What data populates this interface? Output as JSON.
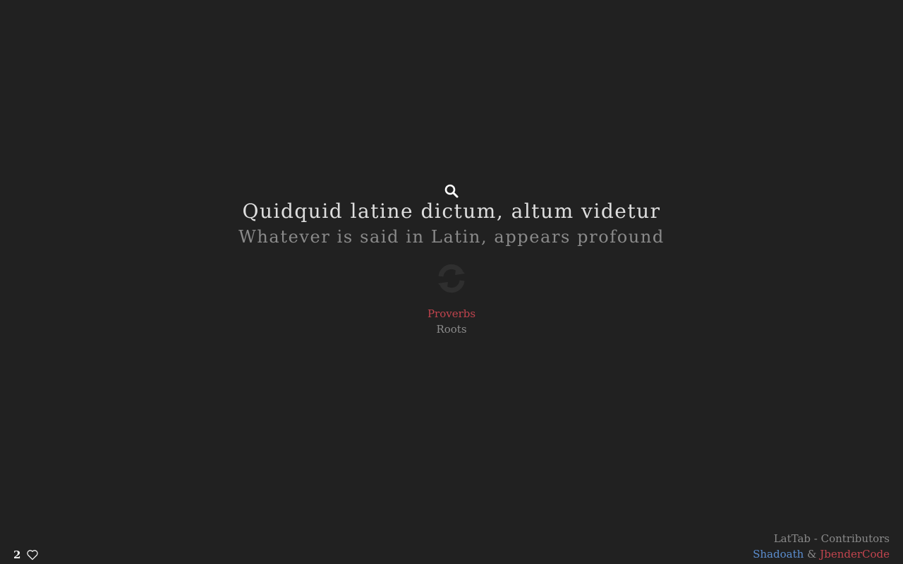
{
  "quote": {
    "latin": "Quidquid latine dictum, altum videtur",
    "english": "Whatever is said in Latin, appears profound"
  },
  "categories": [
    {
      "label": "Proverbs",
      "active": true,
      "color": "#c2444e"
    },
    {
      "label": "Roots",
      "active": false,
      "color": "#8c8c8c"
    }
  ],
  "likes": {
    "count": "2"
  },
  "footer": {
    "title": "LatTab - Contributors",
    "contributors": [
      {
        "name": "Shadoath",
        "color": "#5b8ed0"
      },
      {
        "name": "JbenderCode",
        "color": "#c2444e"
      }
    ],
    "separator": "&"
  },
  "icons": {
    "search": "search-icon",
    "refresh": "refresh-icon",
    "like": "heart-icon"
  },
  "colors": {
    "background": "#212121",
    "accent_red": "#c2444e",
    "accent_blue": "#5b8ed0"
  }
}
